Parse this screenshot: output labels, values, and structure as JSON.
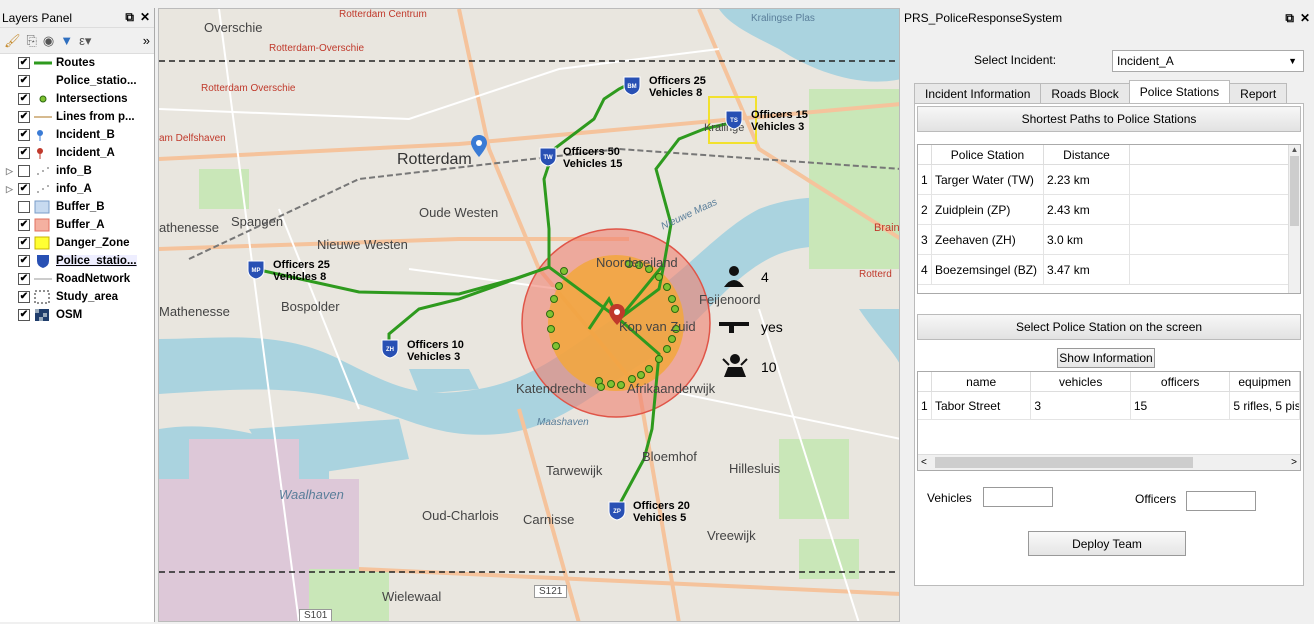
{
  "layers_panel": {
    "title": "Layers Panel",
    "float_icon": "⧉",
    "close_icon": "✕",
    "toolbar_more": "»",
    "layers": [
      {
        "name": "Routes",
        "checked": true,
        "symbol": "line-green"
      },
      {
        "name": "Police_statio...",
        "checked": true,
        "symbol": "none"
      },
      {
        "name": "Intersections",
        "checked": true,
        "symbol": "dot-green"
      },
      {
        "name": "Lines from p...",
        "checked": true,
        "symbol": "line-tan"
      },
      {
        "name": "Incident_B",
        "checked": true,
        "symbol": "pin-blue"
      },
      {
        "name": "Incident_A",
        "checked": true,
        "symbol": "pin-red"
      },
      {
        "name": "info_B",
        "checked": false,
        "symbol": "dots",
        "expandable": true
      },
      {
        "name": "info_A",
        "checked": true,
        "symbol": "dots",
        "expandable": true
      },
      {
        "name": "Buffer_B",
        "checked": false,
        "symbol": "fill-blue"
      },
      {
        "name": "Buffer_A",
        "checked": true,
        "symbol": "fill-salmon"
      },
      {
        "name": "Danger_Zone",
        "checked": true,
        "symbol": "fill-yellow"
      },
      {
        "name": "Police_statio...",
        "checked": true,
        "symbol": "shield-blue",
        "selected": true
      },
      {
        "name": "RoadNetwork",
        "checked": true,
        "symbol": "line-gray"
      },
      {
        "name": "Study_area",
        "checked": true,
        "symbol": "dashed-box"
      },
      {
        "name": "OSM",
        "checked": true,
        "symbol": "checker"
      }
    ]
  },
  "map": {
    "places": {
      "overschie": "Overschie",
      "rotterdam": "Rotterdam",
      "oude_westen": "Oude Westen",
      "spangen": "Spangen",
      "nieuwe_westen": "Nieuwe Westen",
      "athenesse": "athenesse",
      "mathenesse": "Mathenesse",
      "bospolder": "Bospolder",
      "noordereiland": "Noordereiland",
      "feijenoord": "Feijenoord",
      "kop_van_zuid": "Kop van Zuid",
      "katendrecht": "Katendrecht",
      "afrikaanderwijk": "Afrikaanderwijk",
      "tarwewijk": "Tarwewijk",
      "bloemhof": "Bloemhof",
      "hillesluis": "Hillesluis",
      "oud_charlois": "Oud-Charlois",
      "carnisse": "Carnisse",
      "vreewijk": "Vreewijk",
      "waalhaven": "Waalhaven",
      "wielewaal": "Wielewaal",
      "kralingen": "Kralinge",
      "kralingse_plas": "Kralingse Plas",
      "brain": "Brain",
      "s121": "S121",
      "s101": "S101",
      "maashaven": "Maashaven",
      "nieuwe_maas": "Nieuwe Maas"
    },
    "red_labels": {
      "rotterdam_centrum": "Rotterdam Centrum",
      "rotterdam_overschie": "Rotterdam-Overschie",
      "rotterdam_overschie2": "Rotterdam Overschie",
      "delfshaven": "am Delfshaven",
      "rotterdam_right": "Rotterd"
    },
    "stations": [
      {
        "code": "BM",
        "officers_label": "Officers",
        "officers": "25",
        "vehicles_label": "Vehicles",
        "vehicles": "8"
      },
      {
        "code": "TS",
        "officers_label": "Officers",
        "officers": "15",
        "vehicles_label": "Vehicles",
        "vehicles": "3"
      },
      {
        "code": "TW",
        "officers_label": "Officers",
        "officers": "50",
        "vehicles_label": "Vehicles",
        "vehicles": "15"
      },
      {
        "code": "MP",
        "officers_label": "Officers",
        "officers": "25",
        "vehicles_label": "Vehicles",
        "vehicles": "8"
      },
      {
        "code": "ZH",
        "officers_label": "Officers",
        "officers": "10",
        "vehicles_label": "Vehicles",
        "vehicles": "3"
      },
      {
        "code": "ZP",
        "officers_label": "Officers",
        "officers": "20",
        "vehicles_label": "Vehicles",
        "vehicles": "5"
      }
    ],
    "incident_info": {
      "people": "4",
      "armed": "yes",
      "hostages": "10"
    }
  },
  "prs": {
    "title": "PRS_PoliceResponseSystem",
    "select_label": "Select Incident:",
    "selected_incident": "Incident_A",
    "tabs": [
      "Incident Information",
      "Roads Block",
      "Police Stations",
      "Report"
    ],
    "active_tab": "Police Stations",
    "shortest_paths_button": "Shortest Paths to Police Stations",
    "paths_table": {
      "headers": [
        "Police Station",
        "Distance"
      ],
      "rows": [
        {
          "n": "1",
          "station": "Targer Water (TW)",
          "distance": "2.23 km"
        },
        {
          "n": "2",
          "station": "Zuidplein (ZP)",
          "distance": "2.43 km"
        },
        {
          "n": "3",
          "station": "Zeehaven (ZH)",
          "distance": "3.0 km"
        },
        {
          "n": "4",
          "station": "Boezemsingel (BZ)",
          "distance": "3.47 km"
        }
      ]
    },
    "select_station_button": "Select Police Station on the screen",
    "show_info_button": "Show Information",
    "info_table": {
      "headers": [
        "name",
        "vehicles",
        "officers",
        "equipmen"
      ],
      "rows": [
        {
          "n": "1",
          "name": "Tabor Street",
          "vehicles": "3",
          "officers": "15",
          "equipment": "5 rifles, 5 pis"
        }
      ]
    },
    "vehicles_label": "Vehicles",
    "officers_label": "Officers",
    "vehicles_value": "",
    "officers_value": "",
    "deploy_button": "Deploy Team"
  }
}
